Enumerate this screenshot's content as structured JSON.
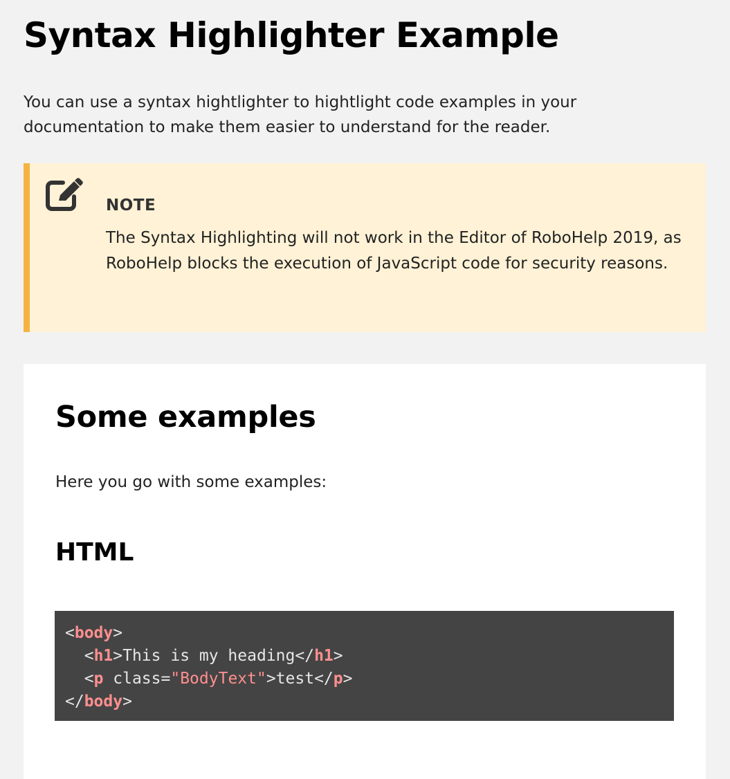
{
  "page": {
    "title": "Syntax Highlighter Example",
    "intro": "You can use a syntax hightlighter to hightlight code examples in your documentation to make them easier to understand for the reader."
  },
  "note": {
    "icon": "edit-note-icon",
    "title": "NOTE",
    "body": "The Syntax Highlighting will not work in the Editor of RoboHelp 2019, as RoboHelp blocks the execution of JavaScript code for security reasons.",
    "colors": {
      "background": "#fff2d6",
      "accent_border": "#f5b342"
    }
  },
  "examples": {
    "heading": "Some examples",
    "lead": "Here you go with some examples:",
    "html_heading": "HTML",
    "code": {
      "line1": {
        "open": "<",
        "tag": "body",
        "close": ">"
      },
      "line2": {
        "indent": "  ",
        "open": "<",
        "tag": "h1",
        "mid": ">This is my heading</",
        "tag2": "h1",
        "close": ">"
      },
      "line3": {
        "indent": "  ",
        "open": "<",
        "tag": "p",
        "attr": " class=",
        "value": "\"BodyText\"",
        "mid": ">test</",
        "tag2": "p",
        "close": ">"
      },
      "line4": {
        "open": "</",
        "tag": "body",
        "close": ">"
      }
    },
    "colors": {
      "code_background": "#444444",
      "code_text": "#e6e6e6",
      "tag_highlight": "#ff8f8f"
    }
  }
}
